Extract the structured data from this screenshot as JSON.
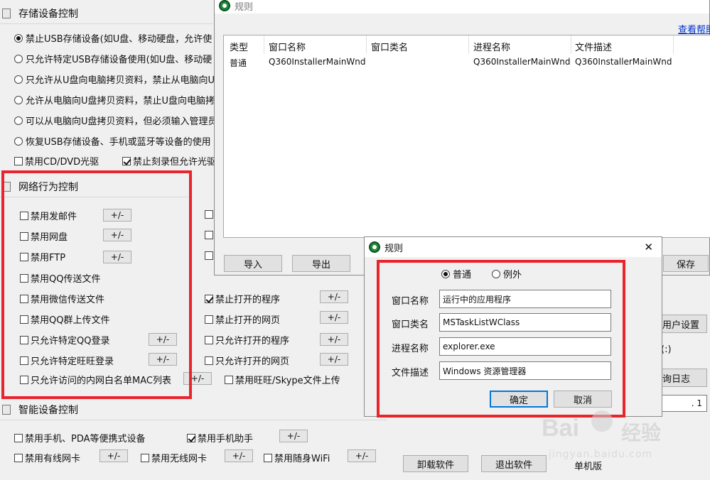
{
  "storage": {
    "title": "存储设备控制",
    "options": [
      "禁止USB存储设备(如U盘、移动硬盘，允许使",
      "只允许特定USB存储设备使用(如U盘、移动硬",
      "只允许从U盘向电脑拷贝资料，禁止从电脑向U",
      "允许从电脑向U盘拷贝资料，禁止U盘向电脑拷",
      "可以从电脑向U盘拷贝资料，但必须输入管理员",
      "恢复USB存储设备、手机或蓝牙等设备的使用"
    ],
    "selected_index": 0,
    "disable_cd": "禁用CD/DVD光驱",
    "burn_allow": "禁止刻录但允许光驱"
  },
  "network": {
    "title": "网络行为控制",
    "items": [
      {
        "label": "禁用发邮件",
        "checked": false
      },
      {
        "label": "禁用网盘",
        "checked": false
      },
      {
        "label": "禁用FTP",
        "checked": false
      },
      {
        "label": "禁用QQ传送文件",
        "checked": false
      },
      {
        "label": "禁用微信传送文件",
        "checked": false
      },
      {
        "label": "禁用QQ群上传文件",
        "checked": false
      },
      {
        "label": "只允许特定QQ登录",
        "checked": false
      },
      {
        "label": "只允许特定旺旺登录",
        "checked": false
      },
      {
        "label": "只允许访问的内网白名单MAC列表",
        "checked": false
      }
    ],
    "right_items": [
      {
        "label": "禁止打开的程序",
        "checked": true
      },
      {
        "label": "禁止打开的网页",
        "checked": false
      },
      {
        "label": "只允许打开的程序",
        "checked": false
      },
      {
        "label": "只允许打开的网页",
        "checked": false
      },
      {
        "label": "禁用旺旺/Skype文件上传",
        "checked": false
      }
    ],
    "pm_label": "+/-"
  },
  "smart": {
    "title": "智能设备控制",
    "items": [
      {
        "label": "禁用手机、PDA等便携式设备",
        "checked": false
      },
      {
        "label": "禁用手机助手",
        "checked": true
      },
      {
        "label": "禁用有线网卡",
        "checked": false
      },
      {
        "label": "禁用无线网卡",
        "checked": false
      },
      {
        "label": "禁用随身WiFi",
        "checked": false
      }
    ]
  },
  "bottom": {
    "uninstall": "卸载软件",
    "exit": "退出软件",
    "edition": "单机版",
    "user_settings": "用户设置",
    "query_log": "询日志",
    "paren": "(:)",
    "dot_one": ". 1"
  },
  "rules_window": {
    "title": "规则",
    "help_link": "查看帮助",
    "columns": [
      "类型",
      "窗口名称",
      "窗口类名",
      "进程名称",
      "文件描述"
    ],
    "rows": [
      [
        "普通",
        "Q360InstallerMainWnd",
        "",
        "Q360InstallerMainWnd",
        "Q360InstallerMainWnd"
      ]
    ],
    "import": "导入",
    "export": "导出",
    "save": "保存"
  },
  "rule_dialog": {
    "title": "规则",
    "close": "✕",
    "type_normal": "普通",
    "type_exception": "例外",
    "window_name_label": "窗口名称",
    "window_name_value": "运行中的应用程序",
    "window_class_label": "窗口类名",
    "window_class_value": "MSTaskListWClass",
    "process_label": "进程名称",
    "process_value": "explorer.exe",
    "filedesc_label": "文件描述",
    "filedesc_value": "Windows 资源管理器",
    "ok": "确定",
    "cancel": "取消"
  },
  "watermark": {
    "brand": "Bai",
    "brand2": "经验",
    "url": "jingyan.baidu.com"
  },
  "colors": {
    "highlight": "#e8242c",
    "link": "#0033cc"
  }
}
